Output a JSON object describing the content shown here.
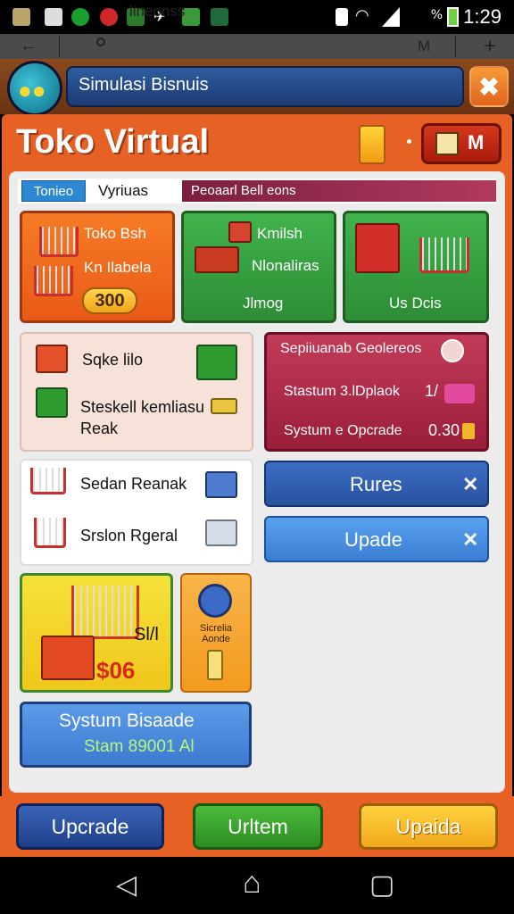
{
  "status_bar": {
    "battery_pct": "%",
    "time": "1:29"
  },
  "browser_bar": {
    "text": "lineonss"
  },
  "header": {
    "title": "Simulasi Bisnuis",
    "close_glyph": "✖"
  },
  "shop": {
    "title": "Toko Virtual",
    "m_button_label": "M"
  },
  "tabs": {
    "tab1": "Tonieo",
    "tab2": "Vyriuas",
    "tab3": "Peoaarl Bell eons"
  },
  "cards": {
    "orange": {
      "line1": "Toko Bsh",
      "line2": "Kn Ilabela",
      "price": "300"
    },
    "green1": {
      "line1": "Kmilsh",
      "line2": "Nlonaliras",
      "line3": "Jlmog"
    },
    "green2": {
      "line1": "Us Dcis"
    },
    "pink": {
      "item1": "Sqke lilo",
      "item2_line1": "Steskell kemliasu",
      "item2_line2": "Reak"
    },
    "darkpink": {
      "line1": "Sepiiuanab Geolereos",
      "line2": "Stastum 3.lDplaok",
      "value2": "1/",
      "line3": "Systum e Opcrade",
      "value3": "0.30"
    },
    "white": {
      "item1": "Sedan Reanak",
      "item2": "Srslon Rgeral"
    },
    "btn_blue1": {
      "label": "Rures",
      "glyph": "✕"
    },
    "btn_blue2": {
      "label": "Upade",
      "glyph": "✕"
    },
    "yellow": {
      "line1": "Sl/l",
      "price": "$06"
    },
    "orange2": {
      "label": "Sicrelia Aonde"
    },
    "sys": {
      "line1": "Systum Bisaade",
      "line2": "Stam 89001 Al"
    }
  },
  "bottom_buttons": {
    "b1": "Upcrade",
    "b2": "Urltem",
    "b3": "Upaida"
  },
  "nav": {
    "back": "◁",
    "home": "⌂",
    "recent": "▢"
  },
  "colors": {
    "primary_orange": "#e76024",
    "green": "#2d8d36",
    "blue": "#28529e",
    "magenta": "#9a1e3a",
    "yellow": "#f0c61b"
  }
}
